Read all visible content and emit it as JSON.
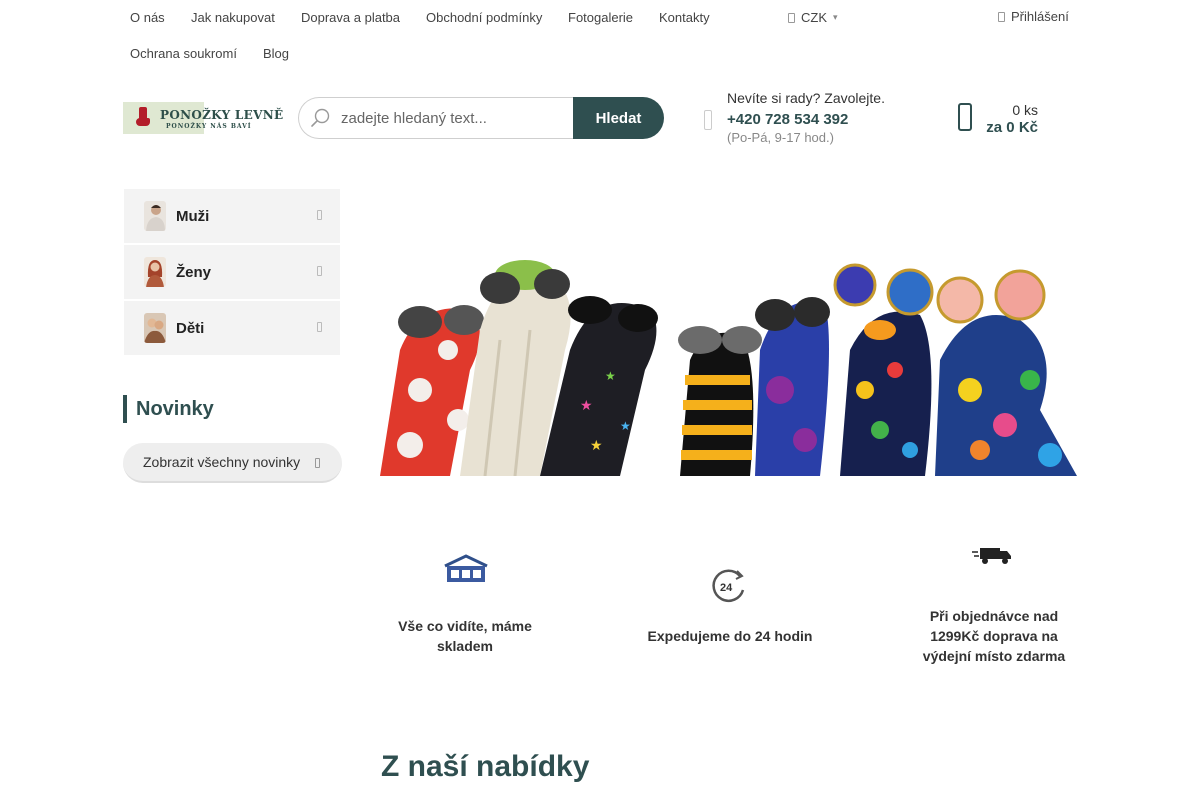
{
  "topnav": {
    "items": [
      "O nás",
      "Jak nakupovat",
      "Doprava a platba",
      "Obchodní podmínky",
      "Fotogalerie",
      "Kontakty",
      "Ochrana soukromí",
      "Blog"
    ],
    "currency": "CZK",
    "login": "Přihlášení"
  },
  "header": {
    "logo_main": "PONOŽKY LEVNĚ",
    "logo_sub": "PONOŽKY NÁS BAVÍ",
    "search_placeholder": "zadejte hledaný text...",
    "search_button": "Hledat",
    "help_title": "Nevíte si rady? Zavolejte.",
    "help_phone": "+420 728 534 392",
    "help_hours": "(Po-Pá, 9-17 hod.)",
    "cart_count": "0 ks",
    "cart_total": "za 0 Kč"
  },
  "sidebar": {
    "categories": [
      {
        "label": "Muži"
      },
      {
        "label": "Ženy"
      },
      {
        "label": "Děti"
      }
    ],
    "news_title": "Novinky",
    "news_button": "Zobrazit všechny novinky"
  },
  "benefits": [
    {
      "line1": "Vše co vidíte, máme",
      "line2": "skladem",
      "line3": ""
    },
    {
      "line1": "Expedujeme do 24 hodin",
      "line2": "",
      "line3": ""
    },
    {
      "line1": "Při objednávce nad",
      "line2": "1299Kč doprava na",
      "line3": "výdejní místo zdarma"
    }
  ],
  "section_title": "Z naší nabídky",
  "colors": {
    "brand": "#2f4f50",
    "accent_red": "#b31d2a",
    "sidebar_bg": "#f3f3f3"
  }
}
